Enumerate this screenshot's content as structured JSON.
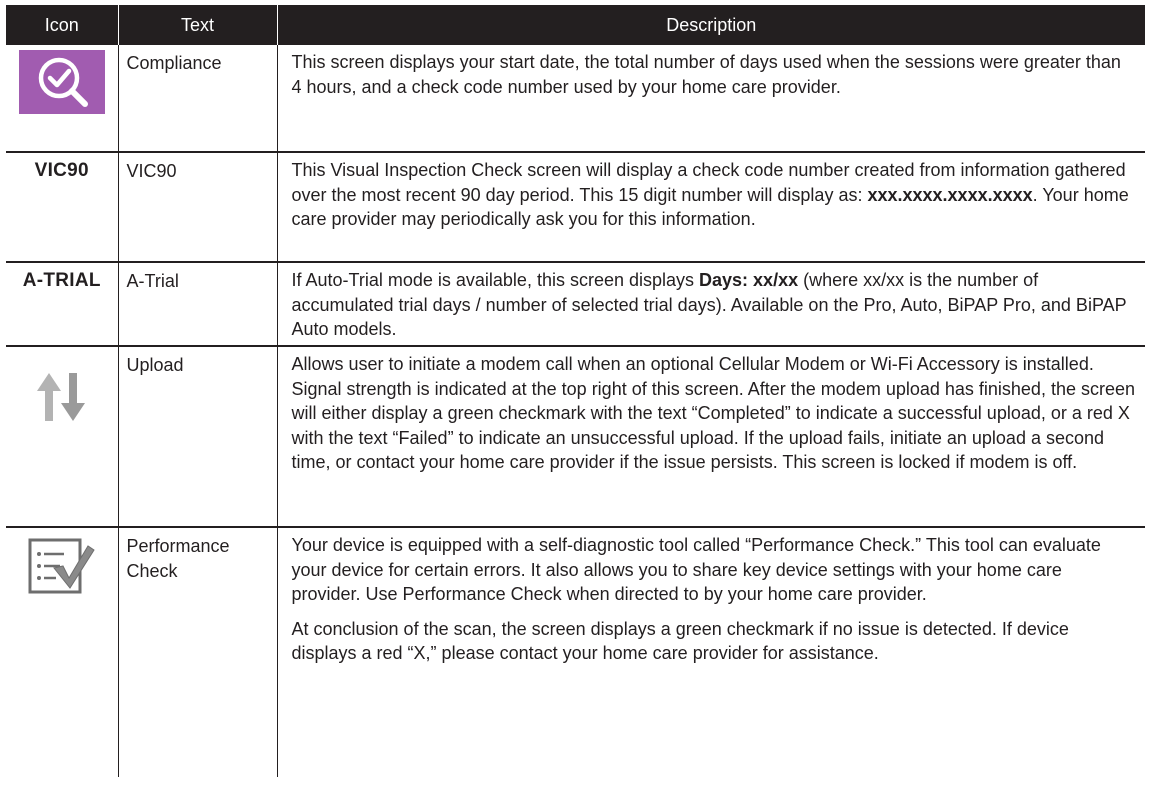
{
  "header": {
    "icon": "Icon",
    "text": "Text",
    "description": "Description"
  },
  "rows": [
    {
      "icon": "magnifier-check-icon",
      "icon_color": "#a15cb0",
      "text": "Compliance",
      "desc": "This screen displays your start date, the total number of days used when the sessions were greater than 4 hours, and a check code number used by your home care provider."
    },
    {
      "icon_text": "VIC90",
      "text": "VIC90",
      "desc_a": "This Visual Inspection Check screen will display a check code number created from information gathered over the most recent 90 day period. This 15 digit number will display as: ",
      "desc_b": "xxx.xxxx.xxxx.xxxx",
      "desc_c": ". Your home care provider may periodically ask you for this information."
    },
    {
      "icon_text": "A-TRIAL",
      "text": "A-Trial",
      "desc_a": "If Auto-Trial mode is available, this screen displays ",
      "desc_b": "Days: xx/xx",
      "desc_c": " (where xx/xx is the number of accumulated trial days / number of selected trial days). Available on the Pro, Auto, BiPAP Pro, and BiPAP Auto models."
    },
    {
      "icon": "upload-arrows-icon",
      "icon_color": "#b0b0b0",
      "text": "Upload",
      "desc": "Allows user to initiate a modem call when an optional Cellular Modem or Wi-Fi Accessory is installed. Signal strength is indicated at the top right of this screen. After the modem upload has finished, the screen will either display a green checkmark with the text “Completed” to indicate a successful upload, or a red X with the text “Failed” to indicate an unsuccessful upload. If the upload fails, initiate an upload a second time, or contact your home care provider if the issue persists. This screen is locked if modem is off."
    },
    {
      "icon": "checklist-check-icon",
      "icon_color": "#7a7a7a",
      "text": "Performance Check",
      "desc_p1": "Your device is equipped with a self-diagnostic tool called “Performance Check.” This tool can evaluate your device for certain errors. It also allows you to share key device settings with your home care provider. Use Performance Check when directed to by your home care provider.",
      "desc_p2": "At conclusion of the scan, the screen displays a green checkmark if no issue is detected. If device displays a red  “X,” please contact your home care provider for assistance."
    }
  ]
}
